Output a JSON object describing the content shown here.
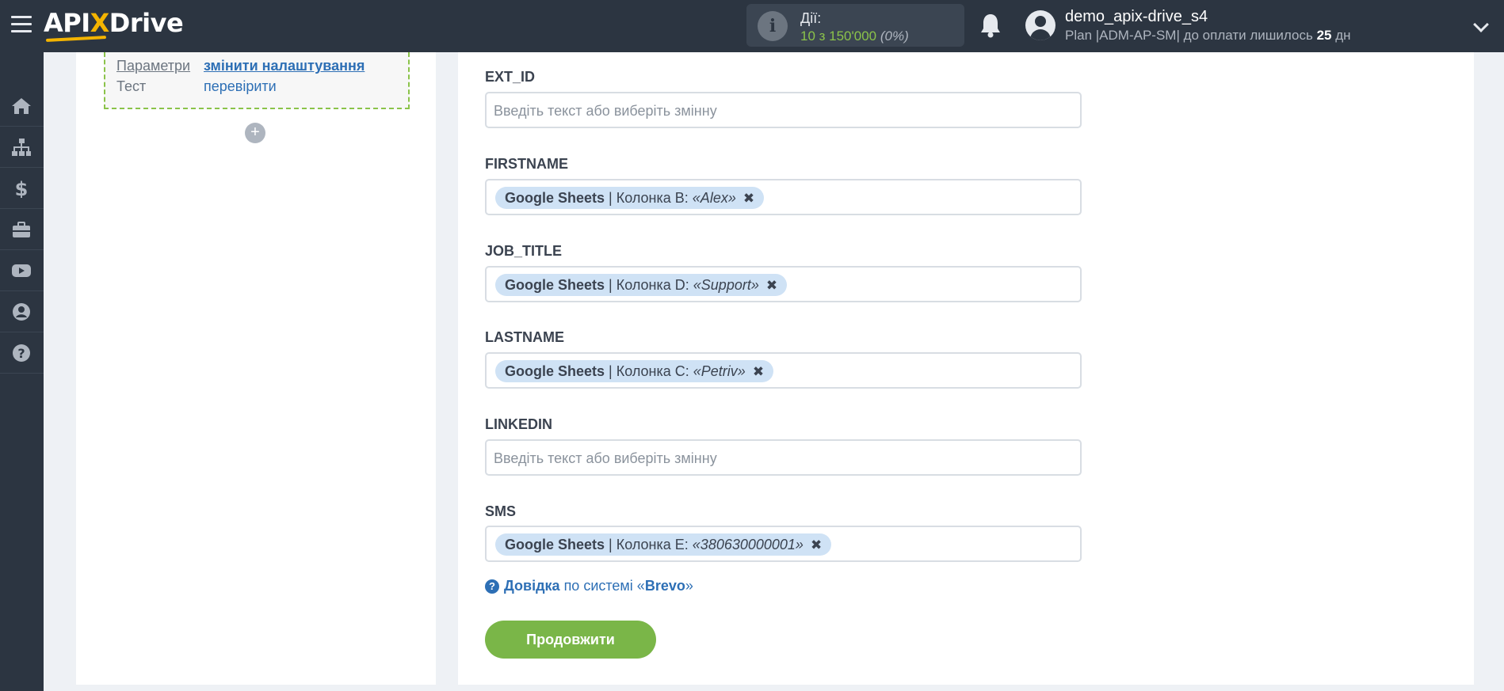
{
  "header": {
    "logo_left": "API",
    "logo_x": "X",
    "logo_right": "Drive",
    "actions_title": "Дії:",
    "actions_count": "10 з 150'000",
    "actions_percent": "(0%)",
    "user_name": "demo_apix-drive_s4",
    "plan_text": "Plan |ADM-AP-SM| до оплати лишилось",
    "plan_days": "25",
    "plan_days_unit": "дн"
  },
  "sidebar": {
    "items": [
      "home-icon",
      "sitemap-icon",
      "dollar-icon",
      "briefcase-icon",
      "youtube-icon",
      "user-circle-icon",
      "help-icon"
    ]
  },
  "left_panel": {
    "rows": [
      {
        "label": "Параметри",
        "value": "змінити налаштування"
      },
      {
        "label": "Тест",
        "value": "перевірити"
      }
    ],
    "add_symbol": "+"
  },
  "form": {
    "fields": [
      {
        "label": "EXT_ID",
        "placeholder": "Введіть текст або виберіть змінну"
      },
      {
        "label": "FIRSTNAME",
        "chip": {
          "service": "Google Sheets",
          "column": "| Колонка B:",
          "value": "«Alex»",
          "remove": "✖"
        }
      },
      {
        "label": "JOB_TITLE",
        "chip": {
          "service": "Google Sheets",
          "column": "| Колонка D:",
          "value": "«Support»",
          "remove": "✖"
        }
      },
      {
        "label": "LASTNAME",
        "chip": {
          "service": "Google Sheets",
          "column": "| Колонка C:",
          "value": "«Petriv»",
          "remove": "✖"
        }
      },
      {
        "label": "LINKEDIN",
        "placeholder": "Введіть текст або виберіть змінну"
      },
      {
        "label": "SMS",
        "chip": {
          "service": "Google Sheets",
          "column": "| Колонка E:",
          "value": "«380630000001»",
          "remove": "✖"
        }
      }
    ],
    "help": {
      "icon": "?",
      "link": "Довідка",
      "middle": " по системі «",
      "system": "Brevo",
      "end": "»"
    },
    "continue_label": "Продовжити"
  },
  "colors": {
    "topbar": "#2c3541",
    "accent_green": "#7ab648",
    "link_blue": "#2d6fb5",
    "chip_bg": "#cfe2f5"
  }
}
